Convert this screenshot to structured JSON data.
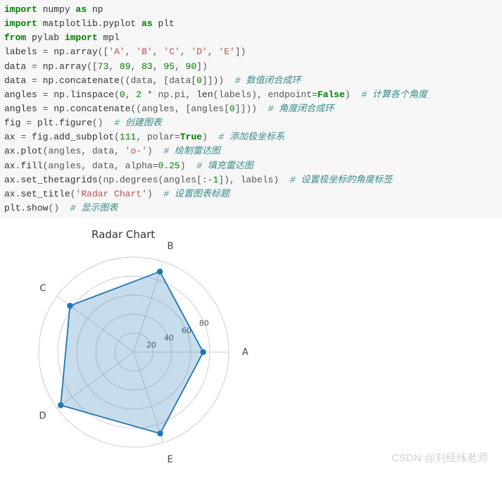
{
  "code": {
    "lines": [
      {
        "segments": [
          {
            "cls": "kw",
            "t": "import"
          },
          {
            "cls": "nm",
            "t": " numpy "
          },
          {
            "cls": "kw",
            "t": "as"
          },
          {
            "cls": "nm",
            "t": " np"
          }
        ]
      },
      {
        "segments": [
          {
            "cls": "kw",
            "t": "import"
          },
          {
            "cls": "nm",
            "t": " matplotlib.pyplot "
          },
          {
            "cls": "kw",
            "t": "as"
          },
          {
            "cls": "nm",
            "t": " plt"
          }
        ]
      },
      {
        "segments": [
          {
            "cls": "kw",
            "t": "from"
          },
          {
            "cls": "nm",
            "t": " pylab "
          },
          {
            "cls": "kw",
            "t": "import"
          },
          {
            "cls": "nm",
            "t": " mpl"
          }
        ]
      },
      {
        "segments": [
          {
            "cls": "nm",
            "t": "labels "
          },
          {
            "cls": "op",
            "t": "="
          },
          {
            "cls": "nm",
            "t": " np"
          },
          {
            "cls": "op",
            "t": "."
          },
          {
            "cls": "fn",
            "t": "array"
          },
          {
            "cls": "op",
            "t": "(["
          },
          {
            "cls": "str",
            "t": "'A'"
          },
          {
            "cls": "op",
            "t": ", "
          },
          {
            "cls": "str",
            "t": "'B'"
          },
          {
            "cls": "op",
            "t": ", "
          },
          {
            "cls": "str",
            "t": "'C'"
          },
          {
            "cls": "op",
            "t": ", "
          },
          {
            "cls": "str",
            "t": "'D'"
          },
          {
            "cls": "op",
            "t": ", "
          },
          {
            "cls": "str",
            "t": "'E'"
          },
          {
            "cls": "op",
            "t": "])"
          }
        ]
      },
      {
        "segments": [
          {
            "cls": "nm",
            "t": "data "
          },
          {
            "cls": "op",
            "t": "="
          },
          {
            "cls": "nm",
            "t": " np"
          },
          {
            "cls": "op",
            "t": "."
          },
          {
            "cls": "fn",
            "t": "array"
          },
          {
            "cls": "op",
            "t": "(["
          },
          {
            "cls": "num",
            "t": "73"
          },
          {
            "cls": "op",
            "t": ", "
          },
          {
            "cls": "num",
            "t": "89"
          },
          {
            "cls": "op",
            "t": ", "
          },
          {
            "cls": "num",
            "t": "83"
          },
          {
            "cls": "op",
            "t": ", "
          },
          {
            "cls": "num",
            "t": "95"
          },
          {
            "cls": "op",
            "t": ", "
          },
          {
            "cls": "num",
            "t": "90"
          },
          {
            "cls": "op",
            "t": "])"
          }
        ]
      },
      {
        "segments": [
          {
            "cls": "nm",
            "t": "data "
          },
          {
            "cls": "op",
            "t": "="
          },
          {
            "cls": "nm",
            "t": " np"
          },
          {
            "cls": "op",
            "t": "."
          },
          {
            "cls": "fn",
            "t": "concatenate"
          },
          {
            "cls": "op",
            "t": "((data, [data["
          },
          {
            "cls": "num",
            "t": "0"
          },
          {
            "cls": "op",
            "t": "]]))  "
          },
          {
            "cls": "com",
            "t": "# 数值闭合成环"
          }
        ]
      },
      {
        "segments": [
          {
            "cls": "nm",
            "t": "angles "
          },
          {
            "cls": "op",
            "t": "="
          },
          {
            "cls": "nm",
            "t": " np"
          },
          {
            "cls": "op",
            "t": "."
          },
          {
            "cls": "fn",
            "t": "linspace"
          },
          {
            "cls": "op",
            "t": "("
          },
          {
            "cls": "num",
            "t": "0"
          },
          {
            "cls": "op",
            "t": ", "
          },
          {
            "cls": "num",
            "t": "2"
          },
          {
            "cls": "op",
            "t": " * np.pi, "
          },
          {
            "cls": "fn",
            "t": "len"
          },
          {
            "cls": "op",
            "t": "(labels), endpoint="
          },
          {
            "cls": "bool",
            "t": "False"
          },
          {
            "cls": "op",
            "t": ")  "
          },
          {
            "cls": "com",
            "t": "# 计算各个角度"
          }
        ]
      },
      {
        "segments": [
          {
            "cls": "nm",
            "t": "angles "
          },
          {
            "cls": "op",
            "t": "="
          },
          {
            "cls": "nm",
            "t": " np"
          },
          {
            "cls": "op",
            "t": "."
          },
          {
            "cls": "fn",
            "t": "concatenate"
          },
          {
            "cls": "op",
            "t": "((angles, [angles["
          },
          {
            "cls": "num",
            "t": "0"
          },
          {
            "cls": "op",
            "t": "]]))  "
          },
          {
            "cls": "com",
            "t": "# 角度闭合成环"
          }
        ]
      },
      {
        "segments": [
          {
            "cls": "nm",
            "t": "fig "
          },
          {
            "cls": "op",
            "t": "="
          },
          {
            "cls": "nm",
            "t": " plt"
          },
          {
            "cls": "op",
            "t": "."
          },
          {
            "cls": "fn",
            "t": "figure"
          },
          {
            "cls": "op",
            "t": "()  "
          },
          {
            "cls": "com",
            "t": "# 创建图表"
          }
        ]
      },
      {
        "segments": [
          {
            "cls": "nm",
            "t": "ax "
          },
          {
            "cls": "op",
            "t": "="
          },
          {
            "cls": "nm",
            "t": " fig"
          },
          {
            "cls": "op",
            "t": "."
          },
          {
            "cls": "fn",
            "t": "add_subplot"
          },
          {
            "cls": "op",
            "t": "("
          },
          {
            "cls": "num",
            "t": "111"
          },
          {
            "cls": "op",
            "t": ", polar="
          },
          {
            "cls": "bool",
            "t": "True"
          },
          {
            "cls": "op",
            "t": ")  "
          },
          {
            "cls": "com",
            "t": "# 添加极坐标系"
          }
        ]
      },
      {
        "segments": [
          {
            "cls": "nm",
            "t": "ax"
          },
          {
            "cls": "op",
            "t": "."
          },
          {
            "cls": "fn",
            "t": "plot"
          },
          {
            "cls": "op",
            "t": "(angles, data, "
          },
          {
            "cls": "str",
            "t": "'o-'"
          },
          {
            "cls": "op",
            "t": ")  "
          },
          {
            "cls": "com",
            "t": "# 绘制雷达图"
          }
        ]
      },
      {
        "segments": [
          {
            "cls": "nm",
            "t": "ax"
          },
          {
            "cls": "op",
            "t": "."
          },
          {
            "cls": "fn",
            "t": "fill"
          },
          {
            "cls": "op",
            "t": "(angles, data, alpha="
          },
          {
            "cls": "num",
            "t": "0.25"
          },
          {
            "cls": "op",
            "t": ")  "
          },
          {
            "cls": "com",
            "t": "# 填充雷达图"
          }
        ]
      },
      {
        "segments": [
          {
            "cls": "nm",
            "t": "ax"
          },
          {
            "cls": "op",
            "t": "."
          },
          {
            "cls": "fn",
            "t": "set_thetagrids"
          },
          {
            "cls": "op",
            "t": "(np.degrees(angles[:-"
          },
          {
            "cls": "num",
            "t": "1"
          },
          {
            "cls": "op",
            "t": "]), labels)  "
          },
          {
            "cls": "com",
            "t": "# 设置极坐标的角度标签"
          }
        ]
      },
      {
        "segments": [
          {
            "cls": "nm",
            "t": "ax"
          },
          {
            "cls": "op",
            "t": "."
          },
          {
            "cls": "fn",
            "t": "set_title"
          },
          {
            "cls": "op",
            "t": "("
          },
          {
            "cls": "str",
            "t": "'Radar Chart'"
          },
          {
            "cls": "op",
            "t": ")  "
          },
          {
            "cls": "com",
            "t": "# 设置图表标题"
          }
        ]
      },
      {
        "segments": [
          {
            "cls": "nm",
            "t": "plt"
          },
          {
            "cls": "op",
            "t": "."
          },
          {
            "cls": "fn",
            "t": "show"
          },
          {
            "cls": "op",
            "t": "()  "
          },
          {
            "cls": "com",
            "t": "# 显示图表"
          }
        ]
      }
    ]
  },
  "chart_data": {
    "type": "radar",
    "title": "Radar Chart",
    "categories": [
      "A",
      "B",
      "C",
      "D",
      "E"
    ],
    "values": [
      73,
      89,
      83,
      95,
      90
    ],
    "r_ticks": [
      20,
      40,
      60,
      80
    ],
    "r_max": 100,
    "color": "#1f77b4",
    "fill_alpha": 0.25
  },
  "watermark": "CSDN @刘经纬老师"
}
